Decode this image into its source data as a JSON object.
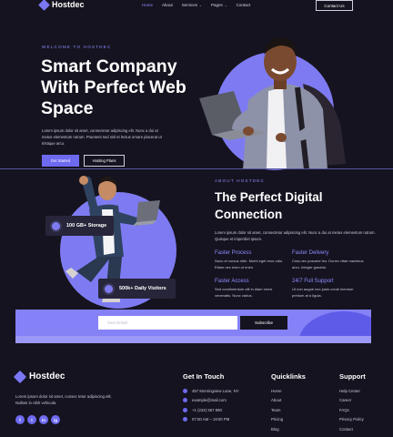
{
  "brand": {
    "name": "Hostdec",
    "accent": "#6e6af0",
    "bg": "#15131f"
  },
  "nav": {
    "items": [
      "Home",
      "About",
      "Services",
      "Pages",
      "Contact"
    ],
    "contact_btn": "Contact Us"
  },
  "hero": {
    "kicker": "WELCOME TO HOSTDEC",
    "title": "Smart Company With Perfect Web Space",
    "description": "Lorem ipsum dolor sit amet, consectetur adipiscing elit. Nunc a dui at metus elementum rutrum. Praesent sed nisl et lectus ornare placerat ut tristique arcu.",
    "btn_primary": "Get Started",
    "btn_secondary": "Hosting Plans"
  },
  "stats": {
    "bandwidth": "100 GB+ Storage",
    "visitors": "500k+ Daily Visitors"
  },
  "about": {
    "kicker": "ABOUT HOSTDEC",
    "title": "The Perfect Digital Connection",
    "description": "Lorem ipsum dolor sit amet, consectetur adipiscing elit. Nunc a dui at metus elementum rutrum. Quisque et imperdiet ipsum.",
    "features": [
      {
        "title": "Faster Process",
        "text": "Nunc et cursus nibh. Morbi eget eros odio. Etiam nec enim ut enim."
      },
      {
        "title": "Faster Delivery",
        "text": "Cras nec posuere leo. Donec vitae maximus arcu. Integer gravida."
      },
      {
        "title": "Faster Access",
        "text": "Sed condimentum elit in diam viverr venenatis. Nunc varius."
      },
      {
        "title": "24/7 Full Support",
        "text": "Ut non augue nec justo condi mentum pretium at a ligula."
      }
    ]
  },
  "newsletter": {
    "placeholder": "Your Email",
    "button": "Subscribe"
  },
  "footer": {
    "brand": "Hostdec",
    "description": "Lorem ipsum dolor sit amet, consec tetur adipiscing elit. Nullam in nibh vehicula.",
    "socials": [
      "f",
      "t",
      "in",
      "ig"
    ],
    "contact_title": "Get In Touch",
    "contact": [
      "457 Morningview Lane, NY",
      "example@mail.com",
      "+1 (234) 567 890",
      "07:00 AM – 19:00 PM"
    ],
    "quicklinks_title": "Quicklinks",
    "quicklinks": [
      "Home",
      "About",
      "Team",
      "Pricing",
      "Blog"
    ],
    "support_title": "Support",
    "support": [
      "Help Center",
      "Career",
      "FAQs",
      "Privacy Policy",
      "Contact"
    ]
  }
}
